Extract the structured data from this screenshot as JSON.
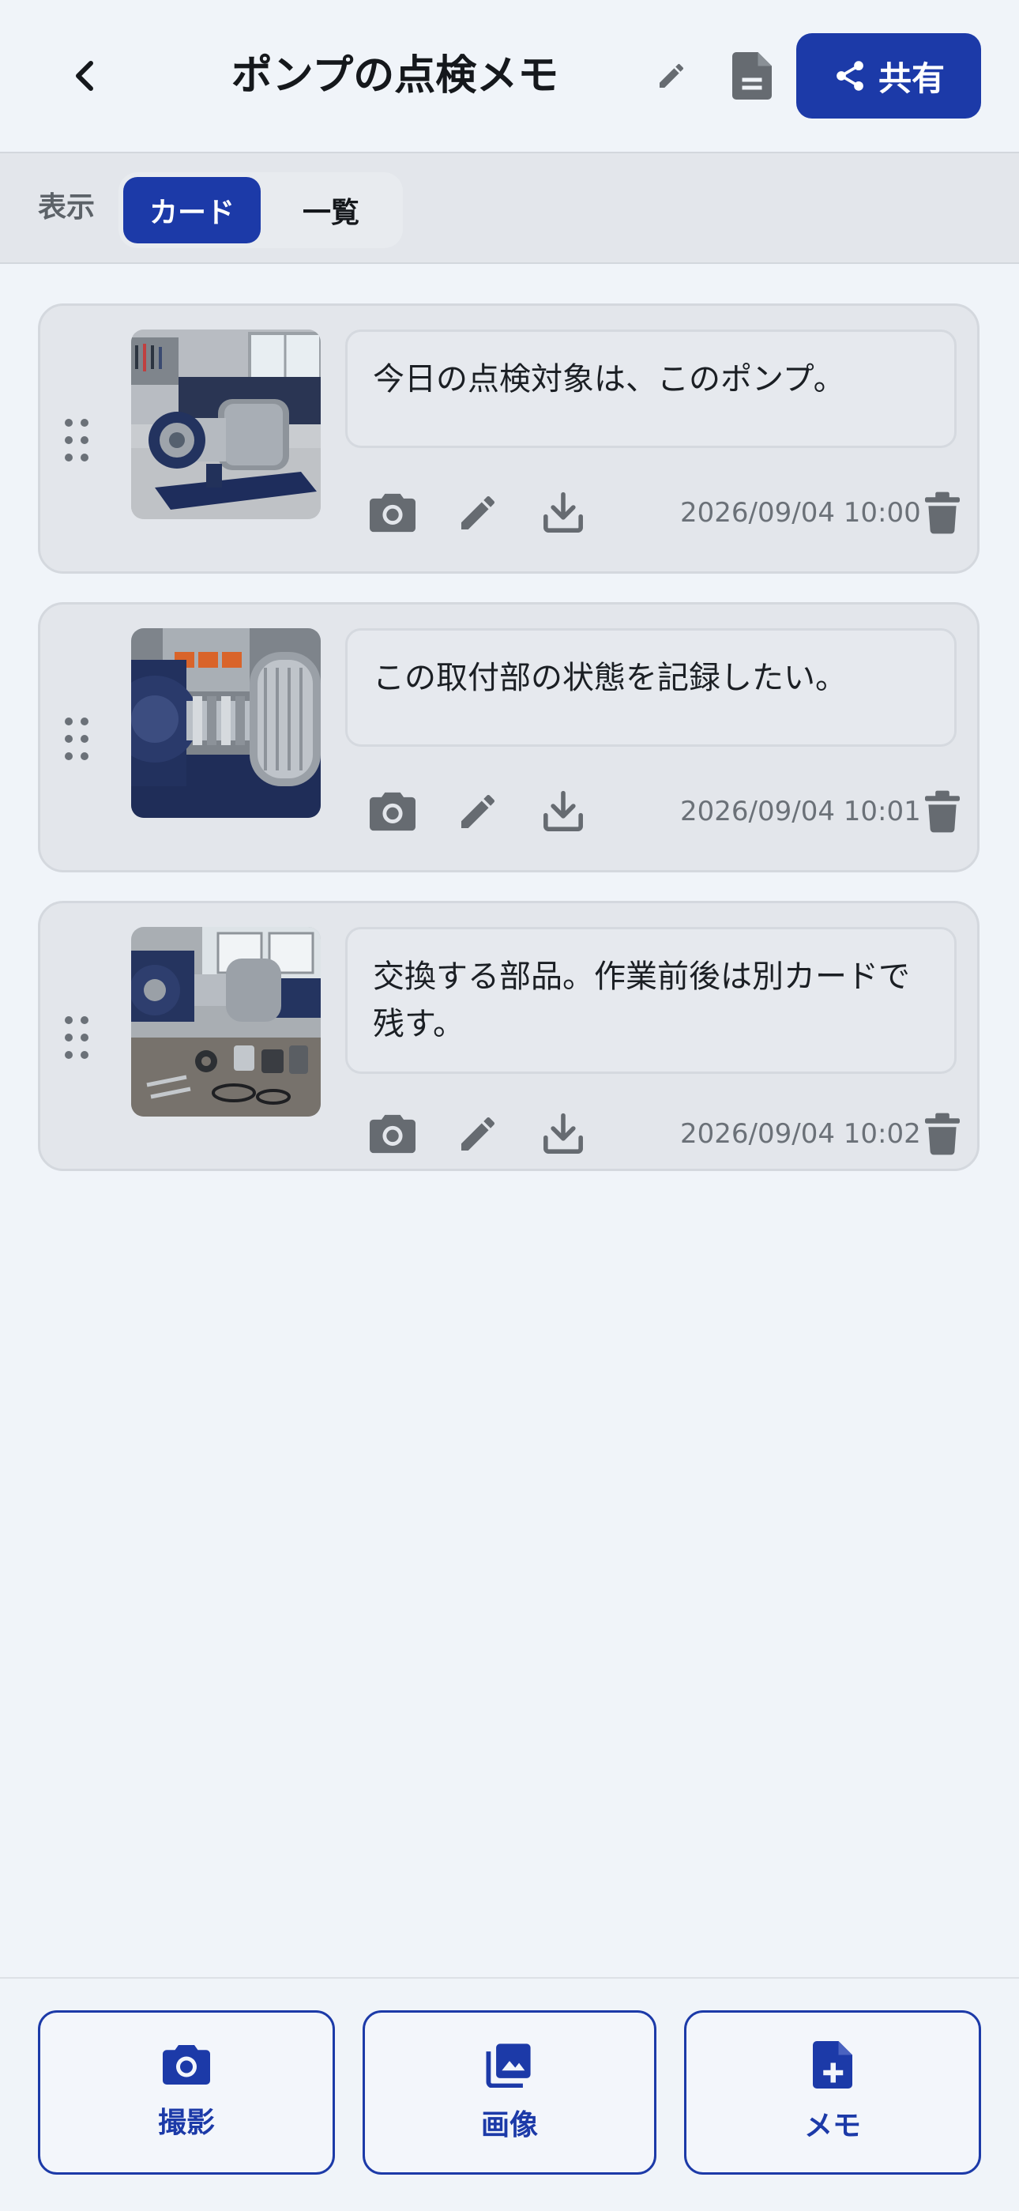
{
  "header": {
    "title": "ポンプの点検メモ",
    "share_label": "共有",
    "icons": {
      "back": "chevron-left-icon",
      "rename": "pencil-icon",
      "document": "document-icon",
      "share": "share-icon"
    }
  },
  "view_toggle": {
    "label": "表示",
    "options": [
      "カード",
      "一覧"
    ],
    "selected": "カード"
  },
  "cards": [
    {
      "text": "今日の点検対象は、このポンプ。",
      "timestamp": "2026/09/04 10:00",
      "image": "pump-overview-photo"
    },
    {
      "text": "この取付部の状態を記録したい。",
      "timestamp": "2026/09/04 10:01",
      "image": "coupling-closeup-photo"
    },
    {
      "text": "交換する部品。作業前後は別カードで残す。",
      "timestamp": "2026/09/04 10:02",
      "image": "parts-on-bench-photo"
    }
  ],
  "card_actions": [
    "camera-icon",
    "pencil-icon",
    "download-icon",
    "trash-icon"
  ],
  "bottom_actions": [
    {
      "label": "撮影",
      "icon": "camera-icon"
    },
    {
      "label": "画像",
      "icon": "gallery-icon"
    },
    {
      "label": "メモ",
      "icon": "add-note-icon"
    }
  ],
  "colors": {
    "accent": "#1c3aa8",
    "background": "#f0f4f9",
    "card": "#e3e6eb",
    "icon_gray": "#666b71"
  }
}
